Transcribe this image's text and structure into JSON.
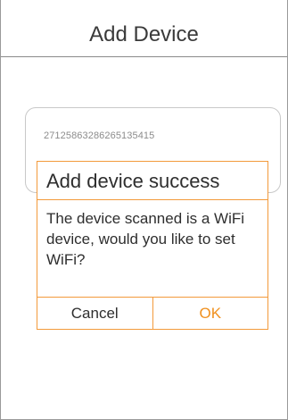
{
  "header": {
    "title": "Add Device"
  },
  "device_code": {
    "value": "27125863286265135415"
  },
  "dialog": {
    "title": "Add device success",
    "message": "The device scanned is a WiFi device, would you like to set WiFi?",
    "cancel_label": "Cancel",
    "ok_label": "OK"
  },
  "colors": {
    "accent": "#f39a3b",
    "ok_text": "#f0901e",
    "divider": "#8a8a8a"
  }
}
